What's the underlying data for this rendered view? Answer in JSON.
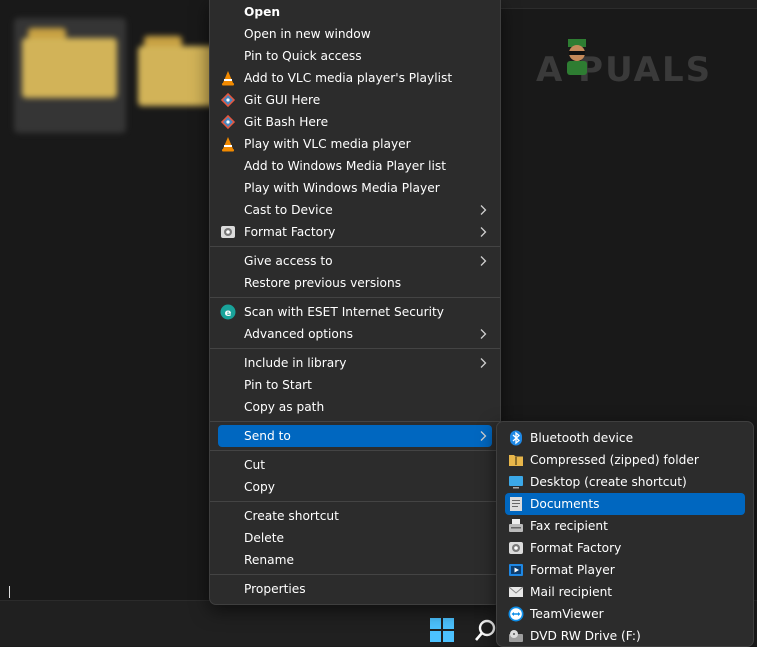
{
  "watermark": {
    "text": "A PUALS"
  },
  "context_menu": {
    "groups": [
      {
        "items": [
          {
            "label": "Open",
            "icon": ""
          },
          {
            "label": "Open in new window",
            "icon": ""
          },
          {
            "label": "Pin to Quick access",
            "icon": ""
          },
          {
            "label": "Add to VLC media player's Playlist",
            "icon": "vlc-icon"
          },
          {
            "label": "Git GUI Here",
            "icon": "git-icon"
          },
          {
            "label": "Git Bash Here",
            "icon": "git-icon"
          },
          {
            "label": "Play with VLC media player",
            "icon": "vlc-icon"
          },
          {
            "label": "Add to Windows Media Player list",
            "icon": ""
          },
          {
            "label": "Play with Windows Media Player",
            "icon": ""
          },
          {
            "label": "Cast to Device",
            "icon": "",
            "submenu": true
          },
          {
            "label": "Format Factory",
            "icon": "format-factory-icon",
            "submenu": true
          }
        ]
      },
      {
        "items": [
          {
            "label": "Give access to",
            "icon": "",
            "submenu": true
          },
          {
            "label": "Restore previous versions",
            "icon": ""
          }
        ]
      },
      {
        "items": [
          {
            "label": "Scan with ESET Internet Security",
            "icon": "eset-icon"
          },
          {
            "label": "Advanced options",
            "icon": "",
            "submenu": true
          }
        ]
      },
      {
        "items": [
          {
            "label": "Include in library",
            "icon": "",
            "submenu": true
          },
          {
            "label": "Pin to Start",
            "icon": ""
          },
          {
            "label": "Copy as path",
            "icon": ""
          }
        ]
      },
      {
        "items": [
          {
            "label": "Send to",
            "icon": "",
            "submenu": true,
            "highlighted": true
          }
        ]
      },
      {
        "items": [
          {
            "label": "Cut",
            "icon": ""
          },
          {
            "label": "Copy",
            "icon": ""
          }
        ]
      },
      {
        "items": [
          {
            "label": "Create shortcut",
            "icon": ""
          },
          {
            "label": "Delete",
            "icon": ""
          },
          {
            "label": "Rename",
            "icon": ""
          }
        ]
      },
      {
        "items": [
          {
            "label": "Properties",
            "icon": ""
          }
        ]
      }
    ]
  },
  "send_to_menu": {
    "items": [
      {
        "label": "Bluetooth device",
        "icon": "bluetooth-icon"
      },
      {
        "label": "Compressed (zipped) folder",
        "icon": "zip-folder-icon"
      },
      {
        "label": "Desktop (create shortcut)",
        "icon": "desktop-icon"
      },
      {
        "label": "Documents",
        "icon": "documents-icon",
        "highlighted": true
      },
      {
        "label": "Fax recipient",
        "icon": "fax-icon"
      },
      {
        "label": "Format Factory",
        "icon": "format-factory-icon"
      },
      {
        "label": "Format Player",
        "icon": "format-player-icon"
      },
      {
        "label": "Mail recipient",
        "icon": "mail-icon"
      },
      {
        "label": "TeamViewer",
        "icon": "teamviewer-icon"
      },
      {
        "label": "DVD RW Drive (F:)",
        "icon": "dvd-drive-icon"
      }
    ]
  },
  "colors": {
    "menu_bg": "#2c2c2c",
    "highlight": "#0067c0",
    "accent": "#4cc2ff"
  }
}
